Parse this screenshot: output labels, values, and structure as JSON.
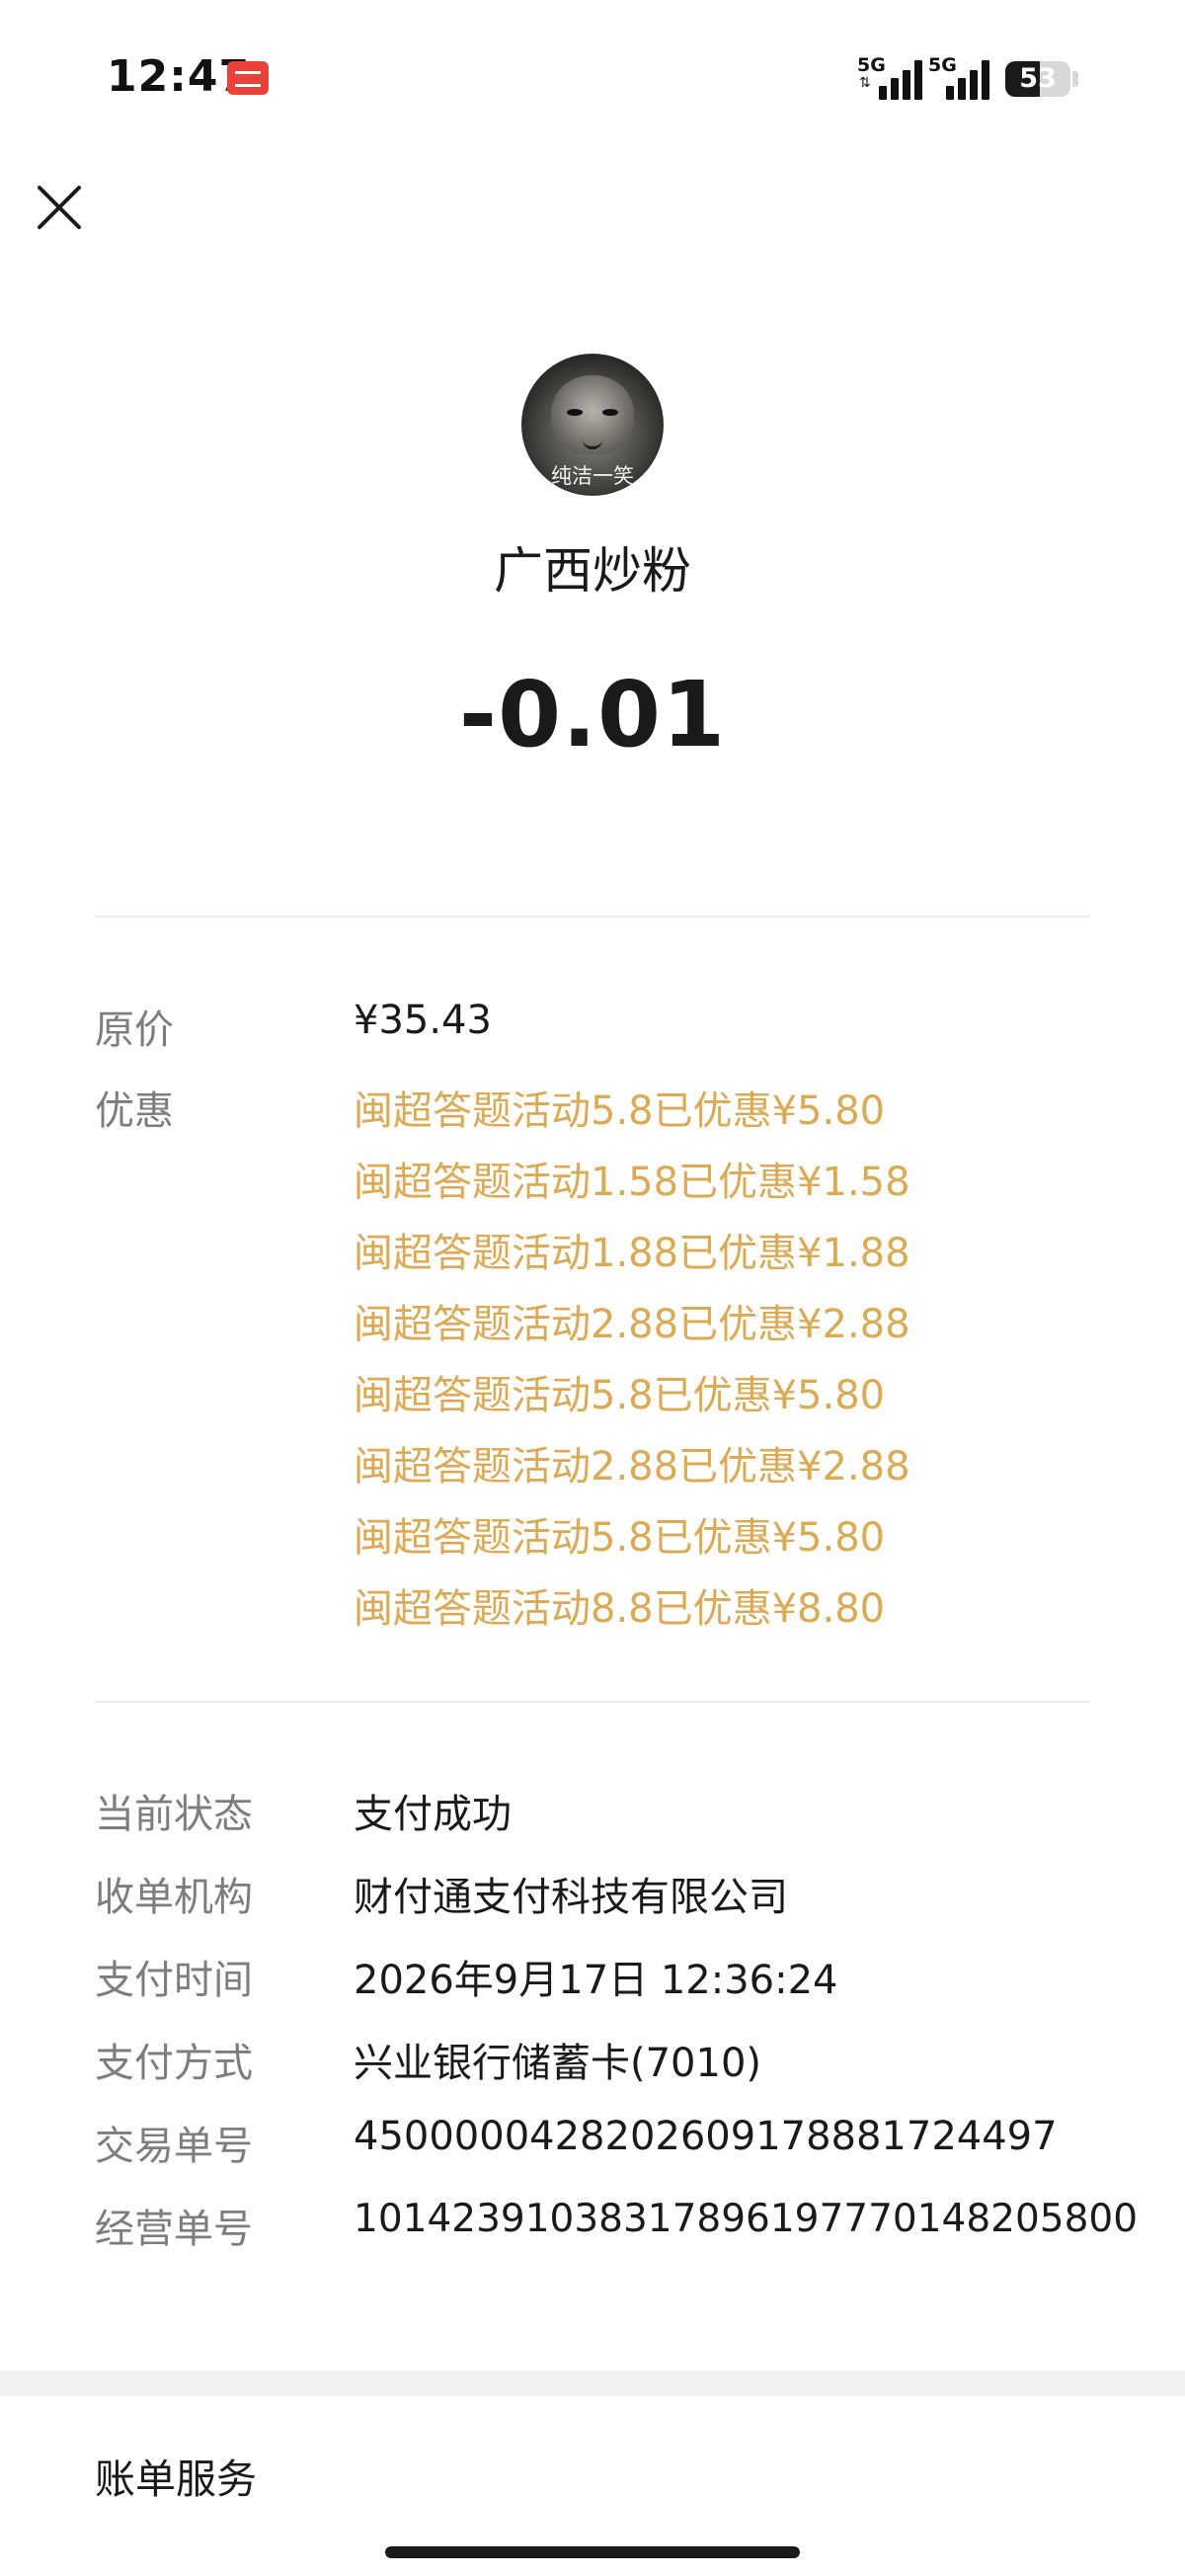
{
  "status_bar": {
    "time": "12:47",
    "network1": "5G",
    "network2": "5G",
    "battery_level": "53"
  },
  "merchant": {
    "name": "广西炒粉",
    "avatar_caption": "纯洁一笑"
  },
  "amount": "-0.01",
  "pricing": {
    "original_label": "原价",
    "original_value": "¥35.43",
    "discount_label": "优惠",
    "discounts": [
      "闽超答题活动5.8已优惠¥5.80",
      "闽超答题活动1.58已优惠¥1.58",
      "闽超答题活动1.88已优惠¥1.88",
      "闽超答题活动2.88已优惠¥2.88",
      "闽超答题活动5.8已优惠¥5.80",
      "闽超答题活动2.88已优惠¥2.88",
      "闽超答题活动5.8已优惠¥5.80",
      "闽超答题活动8.8已优惠¥8.80"
    ]
  },
  "details": [
    {
      "label": "当前状态",
      "value": "支付成功"
    },
    {
      "label": "收单机构",
      "value": "财付通支付科技有限公司"
    },
    {
      "label": "支付时间",
      "value": "2026年9月17日 12:36:24"
    },
    {
      "label": "支付方式",
      "value": "兴业银行储蓄卡(7010)"
    },
    {
      "label": "交易单号",
      "value": "4500000428202609178881724497"
    },
    {
      "label": "经营单号",
      "value": "101423910383178961977701482058​00"
    }
  ],
  "footer": {
    "bill_service": "账单服务"
  },
  "colors": {
    "discount": "#dca954",
    "label": "#7d7d7d",
    "text": "#1a1a1a"
  }
}
